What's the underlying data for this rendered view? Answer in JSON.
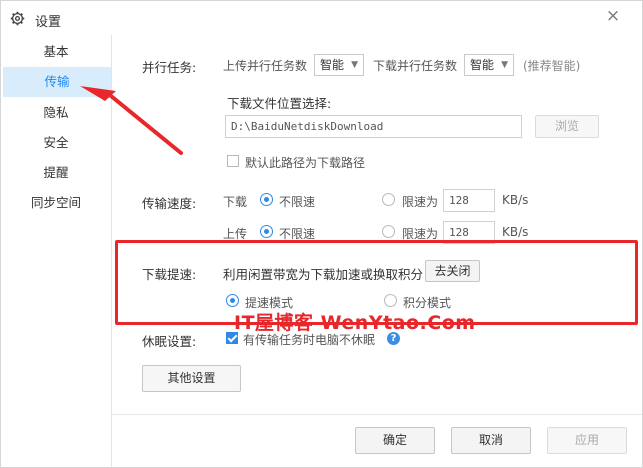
{
  "window": {
    "title": "设置",
    "close": "×"
  },
  "sidebar": {
    "items": [
      {
        "label": "基本"
      },
      {
        "label": "传输"
      },
      {
        "label": "隐私"
      },
      {
        "label": "安全"
      },
      {
        "label": "提醒"
      },
      {
        "label": "同步空间"
      }
    ],
    "active_index": 1
  },
  "parallel": {
    "label": "并行任务:",
    "upload_label": "上传并行任务数",
    "upload_value": "智能",
    "download_label": "下载并行任务数",
    "download_value": "智能",
    "recommend_hint": "(推荐智能)"
  },
  "download_location": {
    "label": "下载文件位置选择:",
    "path": "D:\\BaiduNetdiskDownload",
    "browse_button": "浏览",
    "default_checkbox_label": "默认此路径为下载路径",
    "default_checked": false
  },
  "speed": {
    "label": "传输速度:",
    "download_label": "下载",
    "upload_label": "上传",
    "unlimited": "不限速",
    "limit_to": "限速为",
    "download_limit_value": "128",
    "upload_limit_value": "128",
    "unit": "KB/s",
    "download_unlimited": true,
    "upload_unlimited": true
  },
  "acceleration": {
    "label": "下载提速:",
    "description": "利用闲置带宽为下载加速或换取积分",
    "close_button": "去关闭",
    "mode_speedup": "提速模式",
    "mode_points": "积分模式",
    "selected_mode": "提速模式"
  },
  "sleep": {
    "label": "休眠设置:",
    "checkbox_label": "有传输任务时电脑不休眠",
    "checked": true,
    "help_icon": "?"
  },
  "other_settings_button": "其他设置",
  "footer": {
    "ok": "确定",
    "cancel": "取消",
    "apply": "应用"
  },
  "watermark": "IT屋博客 WenYtao.Com",
  "colors": {
    "accent": "#2e89e6",
    "active_nav_bg": "#d9ecfb",
    "annotation_red": "#e8272a"
  }
}
